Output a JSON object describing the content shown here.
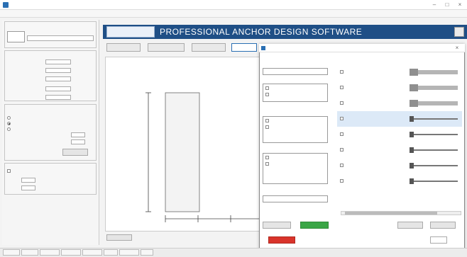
{
  "colors": {
    "header": "#1f4f86",
    "dialog_red_button": "#d9342b",
    "dialog_green_button": "#3aa646",
    "row_highlight": "#dce9f7"
  },
  "header": {
    "title": "PROFESSIONAL ANCHOR DESIGN SOFTWARE"
  },
  "icons": [
    "app-icon",
    "minimize-icon",
    "maximize-icon",
    "close-icon",
    "logo-icon"
  ]
}
